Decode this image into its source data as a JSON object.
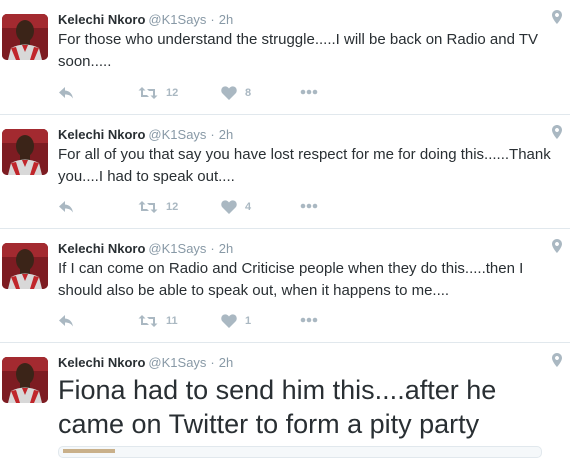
{
  "tweets": [
    {
      "name": "Kelechi Nkoro",
      "handle": "@K1Says",
      "separator": "·",
      "time": "2h",
      "text": "For those who understand the struggle.....I will be back on Radio and TV soon.....",
      "retweets": "12",
      "likes": "8"
    },
    {
      "name": "Kelechi Nkoro",
      "handle": "@K1Says",
      "separator": "·",
      "time": "2h",
      "text": "For all of you that say you have lost respect for me for doing this......Thank you....I had to speak out....",
      "retweets": "12",
      "likes": "4"
    },
    {
      "name": "Kelechi Nkoro",
      "handle": "@K1Says",
      "separator": "·",
      "time": "2h",
      "text": "If I can come on Radio and Criticise people when they do this.....then I should also be able to speak out, when it happens to me....",
      "retweets": "11",
      "likes": "1"
    },
    {
      "name": "Kelechi Nkoro",
      "handle": "@K1Says",
      "separator": "·",
      "time": "2h",
      "text": "Fiona had to send him this....after he came on Twitter to form a pity party"
    }
  ],
  "icons": {
    "reply": "reply-icon",
    "retweet": "retweet-icon",
    "like": "heart-icon",
    "more": "more-icon",
    "location": "location-pin-icon"
  },
  "colors": {
    "icon_gray": "#aab8c2",
    "meta_gray": "#8899a6",
    "text": "#292f33",
    "divider": "#e1e8ed"
  }
}
